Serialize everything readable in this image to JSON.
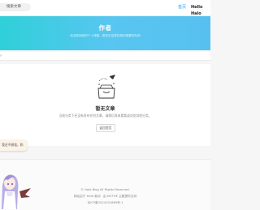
{
  "header": {
    "search_text": "搜索文章",
    "nav_home": "首页",
    "nav_user": "Hello Halo"
  },
  "hero": {
    "title": "作者",
    "subtitle": "欢迎来到我的个人博客，愿你在这里找到你想要的东西"
  },
  "empty_state": {
    "title": "暂无文章",
    "description": "当前分类下还没有发布任何文章，请稍后再来看看或浏览其他分类。",
    "back_button": "返回首页"
  },
  "float_note": {
    "text": "我还不够强，和"
  },
  "footer": {
    "copyright": "© Halo Blog  All Rights Reserved.",
    "powered": "网站由于 Halo 驱动 · 由 NOTHE 主题提供支持",
    "icp": "京ICP备2024101869号-1"
  },
  "colors": {
    "accent": "#2aa0e8",
    "hero_start": "#2fd0d8",
    "hero_end": "#58c0f0",
    "mascot_hair": "#9c8fd6",
    "mascot_wing": "#7a3b3b"
  }
}
